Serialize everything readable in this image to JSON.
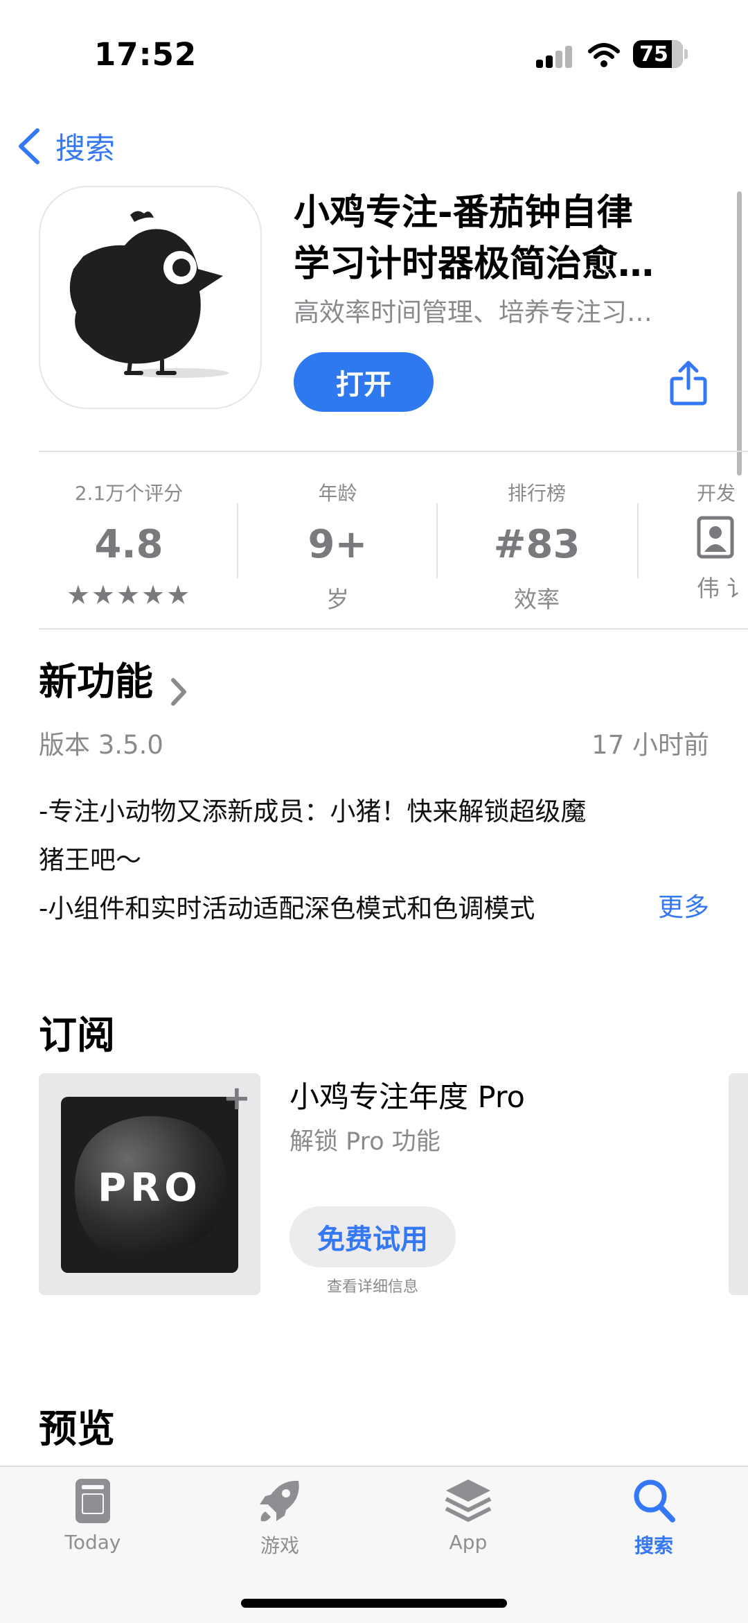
{
  "status_bar": {
    "time": "17:52",
    "battery": "75"
  },
  "nav": {
    "back_label": "搜索"
  },
  "app": {
    "title_line1": "小鸡专注-番茄钟自律",
    "title_line2": "学习计时器极简治愈…",
    "subtitle": "高效率时间管理、培养专注习…",
    "open_label": "打开"
  },
  "stats": [
    {
      "label": "2.1万个评分",
      "value": "4.8",
      "sub": "★★★★★"
    },
    {
      "label": "年龄",
      "value": "9+",
      "sub": "岁"
    },
    {
      "label": "排行榜",
      "value": "#83",
      "sub": "效率"
    },
    {
      "label": "开发",
      "sub": "伟 讠"
    }
  ],
  "whats_new": {
    "title": "新功能",
    "version": "版本 3.5.0",
    "time_ago": "17 小时前",
    "notes": [
      "-专注小动物又添新成员：小猪！快来解锁超级魔",
      "猪王吧～",
      "-小组件和实时活动适配深色模式和色调模式"
    ],
    "more_label": "更多"
  },
  "subscription": {
    "title": "订阅",
    "name": "小鸡专注年度 Pro",
    "description": "解锁 Pro 功能",
    "image_text": "PRO",
    "try_label": "免费试用",
    "details_label": "查看详细信息"
  },
  "preview": {
    "title": "预览"
  },
  "tab_bar": {
    "items": [
      {
        "label": "Today",
        "icon": "today-icon"
      },
      {
        "label": "游戏",
        "icon": "rocket-icon"
      },
      {
        "label": "App",
        "icon": "app-stack-icon"
      },
      {
        "label": "搜索",
        "icon": "search-icon"
      }
    ],
    "active": "搜索"
  },
  "colors": {
    "accent": "#3478f6",
    "open_button": "#2f79f0",
    "secondary_text": "#8a8a8e"
  }
}
